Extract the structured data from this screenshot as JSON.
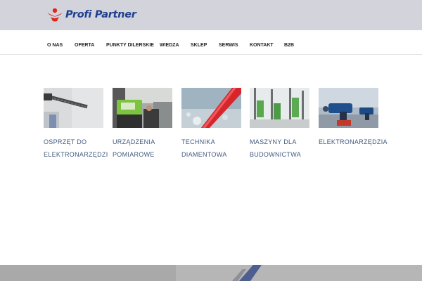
{
  "brand": {
    "name": "Profi Partner",
    "color": "#1f3f8f",
    "accent": "#e2241a"
  },
  "nav": {
    "items": [
      {
        "label": "O NAS"
      },
      {
        "label": "OFERTA"
      },
      {
        "label": "PUNKTY DILERSKIE"
      },
      {
        "label": "WIEDZA"
      },
      {
        "label": "SKLEP"
      },
      {
        "label": "SERWIS"
      },
      {
        "label": "KONTAKT"
      },
      {
        "label": "B2B"
      }
    ]
  },
  "categories": [
    {
      "line1": "OSPRZĘT DO",
      "line2": "ELEKTRONARZĘDZI",
      "image": "drill-bit-photo"
    },
    {
      "line1": "URZĄDZENIA",
      "line2": "POMIAROWE",
      "image": "laser-level-photo"
    },
    {
      "line1": "TECHNIKA",
      "line2": "DIAMENTOWA",
      "image": "diamond-core-bit-photo"
    },
    {
      "line1": "MASZYNY DLA",
      "line2": "BUDOWNICTWA",
      "image": "core-drill-rigs-photo"
    },
    {
      "line1": "ELEKTRONARZĘDZIA",
      "line2": "",
      "image": "power-tools-photo"
    }
  ],
  "colors": {
    "topbar": "#d3d4db",
    "label": "#435a7e",
    "footer": "#b8b8b8"
  }
}
